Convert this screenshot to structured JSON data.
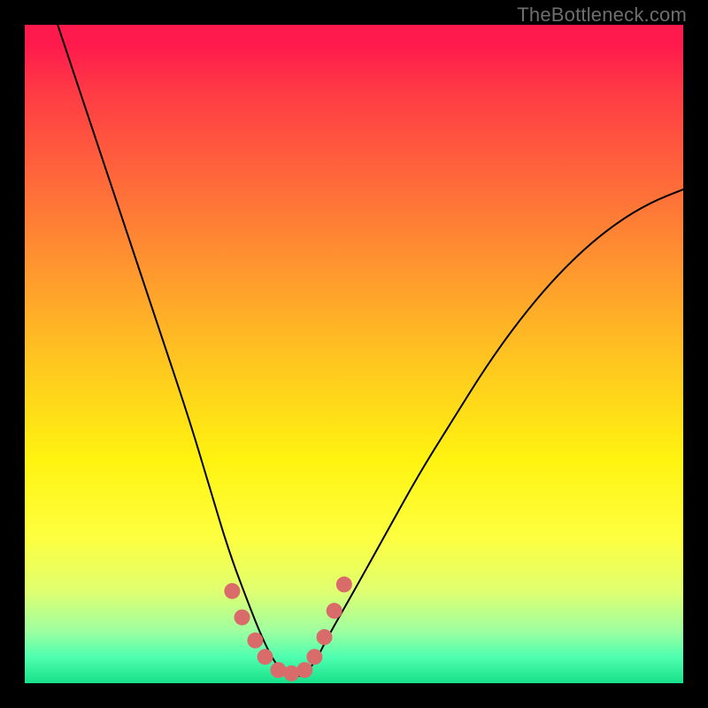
{
  "attribution": "TheBottleneck.com",
  "chart_data": {
    "type": "line",
    "title": "",
    "xlabel": "",
    "ylabel": "",
    "xlim": [
      0,
      100
    ],
    "ylim": [
      0,
      100
    ],
    "grid": false,
    "series": [
      {
        "name": "bottleneck-curve",
        "x": [
          5,
          10,
          15,
          20,
          25,
          28,
          31,
          34,
          36,
          38,
          40,
          42,
          44,
          46,
          50,
          55,
          60,
          65,
          70,
          75,
          80,
          85,
          90,
          95,
          100
        ],
        "y": [
          100,
          85,
          70,
          55,
          40,
          30,
          20,
          12,
          7,
          3,
          1,
          1,
          3,
          7,
          14,
          23,
          32,
          40,
          48,
          55,
          61,
          66,
          70,
          73,
          75
        ]
      }
    ],
    "annotations": [
      {
        "name": "min-marker-cluster",
        "color": "#d96b6b",
        "points_x": [
          31.5,
          33.0,
          35.0,
          36.5,
          38.5,
          40.5,
          42.5,
          44.0,
          45.5,
          47.0,
          48.5
        ],
        "points_y": [
          14.0,
          10.0,
          6.5,
          4.0,
          2.0,
          1.5,
          2.0,
          4.0,
          7.0,
          11.0,
          15.0
        ]
      }
    ],
    "background_gradient_stops": [
      {
        "pos": 0,
        "color": "#ff1a4d"
      },
      {
        "pos": 24,
        "color": "#ff6a3a"
      },
      {
        "pos": 52,
        "color": "#ffc91f"
      },
      {
        "pos": 78,
        "color": "#fdff40"
      },
      {
        "pos": 96,
        "color": "#4fffb0"
      },
      {
        "pos": 100,
        "color": "#18e08a"
      }
    ]
  }
}
